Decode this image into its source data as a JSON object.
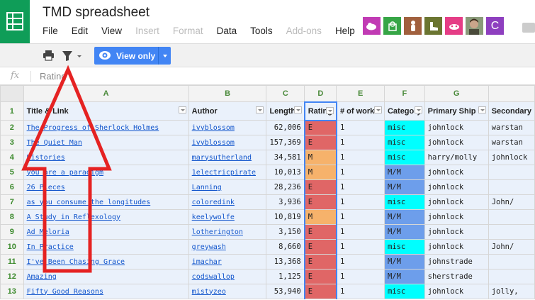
{
  "app": {
    "title": "TMD spreadsheet",
    "menu": [
      {
        "label": "File",
        "disabled": false
      },
      {
        "label": "Edit",
        "disabled": false
      },
      {
        "label": "View",
        "disabled": false
      },
      {
        "label": "Insert",
        "disabled": true
      },
      {
        "label": "Format",
        "disabled": true
      },
      {
        "label": "Data",
        "disabled": false
      },
      {
        "label": "Tools",
        "disabled": false
      },
      {
        "label": "Add-ons",
        "disabled": true
      },
      {
        "label": "Help",
        "disabled": false
      }
    ],
    "collaborator_initial": "C"
  },
  "toolbar": {
    "view_only_label": "View only"
  },
  "formula_bar": {
    "fx_label": "fx",
    "value": "Rating"
  },
  "grid": {
    "columns": [
      "A",
      "B",
      "C",
      "D",
      "E",
      "F",
      "G",
      ""
    ],
    "headers": [
      "Title & Link",
      "Author",
      "Length",
      "Rating",
      "# of works",
      "Category",
      "Primary Ship",
      "Secondary"
    ],
    "header_row_number": "1",
    "rows": [
      {
        "n": "2",
        "title": "The Progress of Sherlock Holmes",
        "author": "ivyblossom",
        "length": "62,006",
        "rating": "E",
        "works": "1",
        "cat": "misc",
        "ship": "johnlock",
        "sec": "warstan"
      },
      {
        "n": "3",
        "title": "The Quiet Man",
        "author": "ivyblossom",
        "length": "157,369",
        "rating": "E",
        "works": "1",
        "cat": "misc",
        "ship": "johnlock",
        "sec": "warstan"
      },
      {
        "n": "4",
        "title": "Histories",
        "author": "marysutherland",
        "length": "34,581",
        "rating": "M",
        "works": "1",
        "cat": "misc",
        "ship": "harry/molly",
        "sec": "johnlock"
      },
      {
        "n": "5",
        "title": "you are a paradigm",
        "author": "1electricpirate",
        "length": "10,013",
        "rating": "M",
        "works": "1",
        "cat": "M/M",
        "ship": "johnlock",
        "sec": ""
      },
      {
        "n": "6",
        "title": "26 Pieces",
        "author": "Lanning",
        "length": "28,236",
        "rating": "E",
        "works": "1",
        "cat": "M/M",
        "ship": "johnlock",
        "sec": ""
      },
      {
        "n": "7",
        "title": "as you consume the longitudes",
        "author": "coloredink",
        "length": "3,936",
        "rating": "E",
        "works": "1",
        "cat": "misc",
        "ship": "johnlock",
        "sec": "John/"
      },
      {
        "n": "8",
        "title": "A Study in Reflexology",
        "author": "keelywolfe",
        "length": "10,819",
        "rating": "M",
        "works": "1",
        "cat": "M/M",
        "ship": "johnlock",
        "sec": ""
      },
      {
        "n": "9",
        "title": "Ad Meloria",
        "author": "lotherington",
        "length": "3,150",
        "rating": "E",
        "works": "1",
        "cat": "M/M",
        "ship": "johnlock",
        "sec": ""
      },
      {
        "n": "10",
        "title": "In Practice",
        "author": "greywash",
        "length": "8,660",
        "rating": "E",
        "works": "1",
        "cat": "misc",
        "ship": "johnlock",
        "sec": "John/"
      },
      {
        "n": "11",
        "title": "I've Been Chasing Grace",
        "author": "imachar",
        "length": "13,368",
        "rating": "E",
        "works": "1",
        "cat": "M/M",
        "ship": "johnstrade",
        "sec": ""
      },
      {
        "n": "12",
        "title": "Amazing",
        "author": "codswallop",
        "length": "1,125",
        "rating": "E",
        "works": "1",
        "cat": "M/M",
        "ship": "sherstrade",
        "sec": ""
      },
      {
        "n": "13",
        "title": "Fifty Good Reasons",
        "author": "mistyzeo",
        "length": "53,940",
        "rating": "E",
        "works": "1",
        "cat": "misc",
        "ship": "johnlock",
        "sec": "jolly,"
      }
    ]
  },
  "colors": {
    "sheets_green": "#0f9d58",
    "rating_E": "#e06666",
    "rating_M": "#f6b26b",
    "cat_misc": "#00ffff",
    "cat_MM": "#6d9eeb",
    "link": "#1155cc",
    "button_blue": "#4285f4",
    "arrow_red": "#e52222"
  }
}
